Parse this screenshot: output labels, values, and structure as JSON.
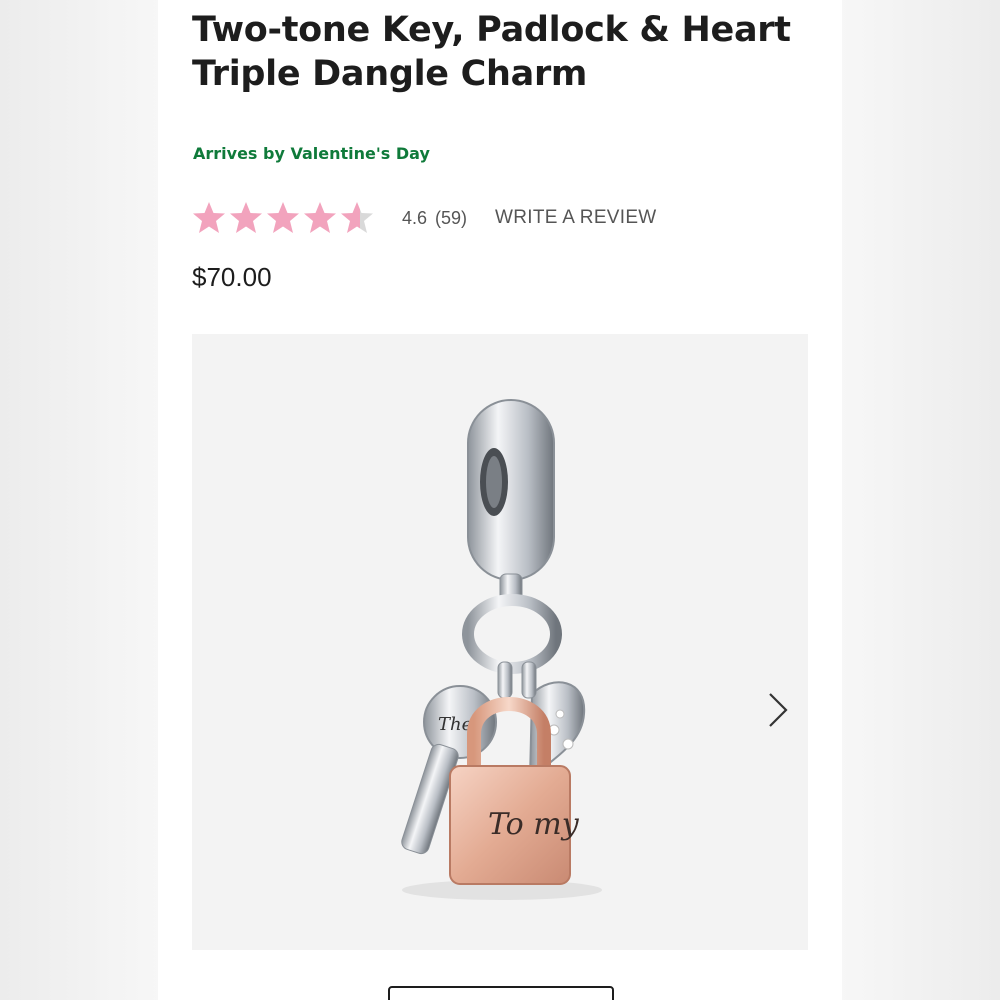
{
  "product": {
    "title": "Two-tone Key, Padlock & Heart Triple Dangle Charm",
    "delivery_note": "Arrives by Valentine's Day",
    "rating": {
      "value": "4.6",
      "count": "(59)",
      "stars": 4.6,
      "write_review_label": "WRITE A REVIEW"
    },
    "price": "$70.00",
    "image": {
      "engraving_padlock": "To my",
      "engraving_key": "The",
      "next_icon": "chevron-right-icon"
    }
  },
  "colors": {
    "star": "#f2a3bd",
    "star_empty": "#d9d9d9",
    "delivery": "#0f7a3a",
    "rose_gold": "#e8b6a0",
    "silver": "#c9ccd1"
  }
}
